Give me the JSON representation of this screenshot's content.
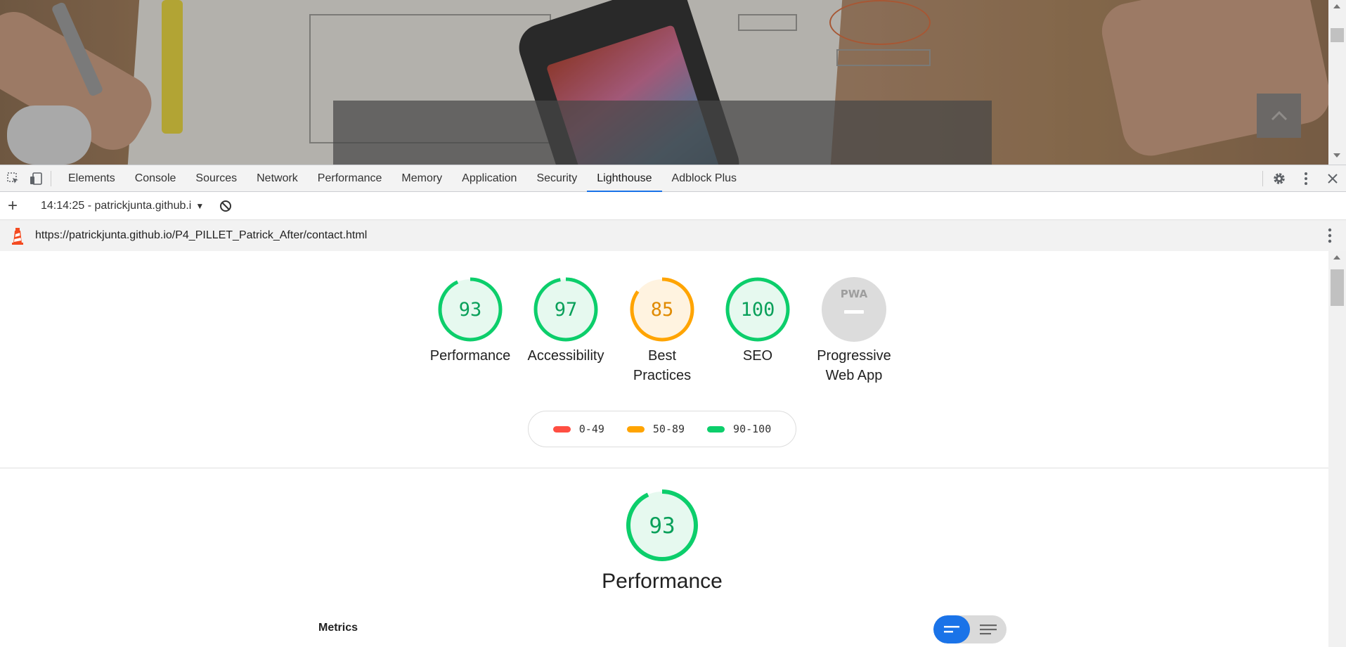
{
  "devtools": {
    "tabs": [
      {
        "label": "Elements"
      },
      {
        "label": "Console"
      },
      {
        "label": "Sources"
      },
      {
        "label": "Network"
      },
      {
        "label": "Performance"
      },
      {
        "label": "Memory"
      },
      {
        "label": "Application"
      },
      {
        "label": "Security"
      },
      {
        "label": "Lighthouse",
        "active": true
      },
      {
        "label": "Adblock Plus"
      }
    ],
    "accent_color": "#1a73e8"
  },
  "toolbar": {
    "report_select": "14:14:25 - patrickjunta.github.i"
  },
  "report": {
    "url": "https://patrickjunta.github.io/P4_PILLET_Patrick_After/contact.html",
    "categories": [
      {
        "id": "performance",
        "label_lines": [
          "Performance"
        ],
        "score": "93",
        "fraction": 0.93,
        "status": "pass"
      },
      {
        "id": "accessibility",
        "label_lines": [
          "Accessibility"
        ],
        "score": "97",
        "fraction": 0.97,
        "status": "pass"
      },
      {
        "id": "best-practices",
        "label_lines": [
          "Best",
          "Practices"
        ],
        "score": "85",
        "fraction": 0.85,
        "status": "average"
      },
      {
        "id": "seo",
        "label_lines": [
          "SEO"
        ],
        "score": "100",
        "fraction": 1.0,
        "status": "pass"
      },
      {
        "id": "pwa",
        "label_lines": [
          "Progressive",
          "Web App"
        ],
        "badge": "PWA",
        "status": "na"
      }
    ],
    "legend": [
      {
        "range": "0-49",
        "color": "#ff4e42"
      },
      {
        "range": "50-89",
        "color": "#ffa400"
      },
      {
        "range": "90-100",
        "color": "#0cce6b"
      }
    ],
    "performance_section": {
      "score": "93",
      "fraction": 0.93,
      "title": "Performance",
      "metrics_label": "Metrics"
    },
    "colors": {
      "pass": "#0cce6b",
      "pass_text": "#0aa05a",
      "pass_bg": "#e6f9ef",
      "average": "#ffa400",
      "average_text": "#e08a00",
      "average_bg": "#fff3e0",
      "na": "#d9d9d9"
    }
  }
}
